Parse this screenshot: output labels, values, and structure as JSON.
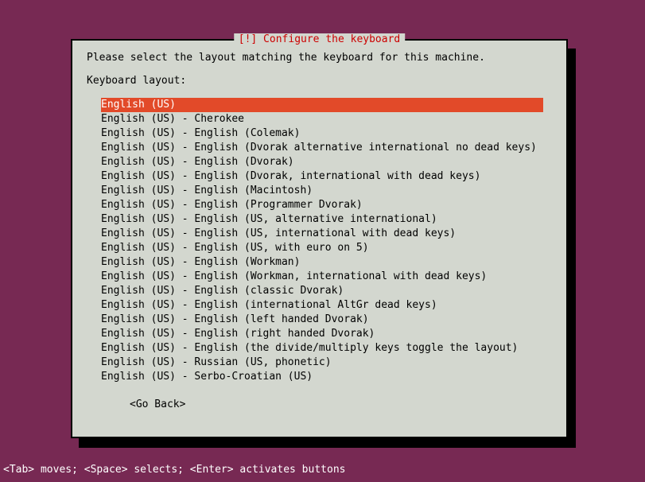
{
  "dialog": {
    "title": "[!] Configure the keyboard",
    "prompt": "Please select the layout matching the keyboard for this machine.",
    "label": "Keyboard layout:",
    "selected_index": 0,
    "items": [
      "English (US)",
      "English (US) - Cherokee",
      "English (US) - English (Colemak)",
      "English (US) - English (Dvorak alternative international no dead keys)",
      "English (US) - English (Dvorak)",
      "English (US) - English (Dvorak, international with dead keys)",
      "English (US) - English (Macintosh)",
      "English (US) - English (Programmer Dvorak)",
      "English (US) - English (US, alternative international)",
      "English (US) - English (US, international with dead keys)",
      "English (US) - English (US, with euro on 5)",
      "English (US) - English (Workman)",
      "English (US) - English (Workman, international with dead keys)",
      "English (US) - English (classic Dvorak)",
      "English (US) - English (international AltGr dead keys)",
      "English (US) - English (left handed Dvorak)",
      "English (US) - English (right handed Dvorak)",
      "English (US) - English (the divide/multiply keys toggle the layout)",
      "English (US) - Russian (US, phonetic)",
      "English (US) - Serbo-Croatian (US)"
    ],
    "go_back": "<Go Back>"
  },
  "footer": {
    "hint": "<Tab> moves; <Space> selects; <Enter> activates buttons"
  }
}
